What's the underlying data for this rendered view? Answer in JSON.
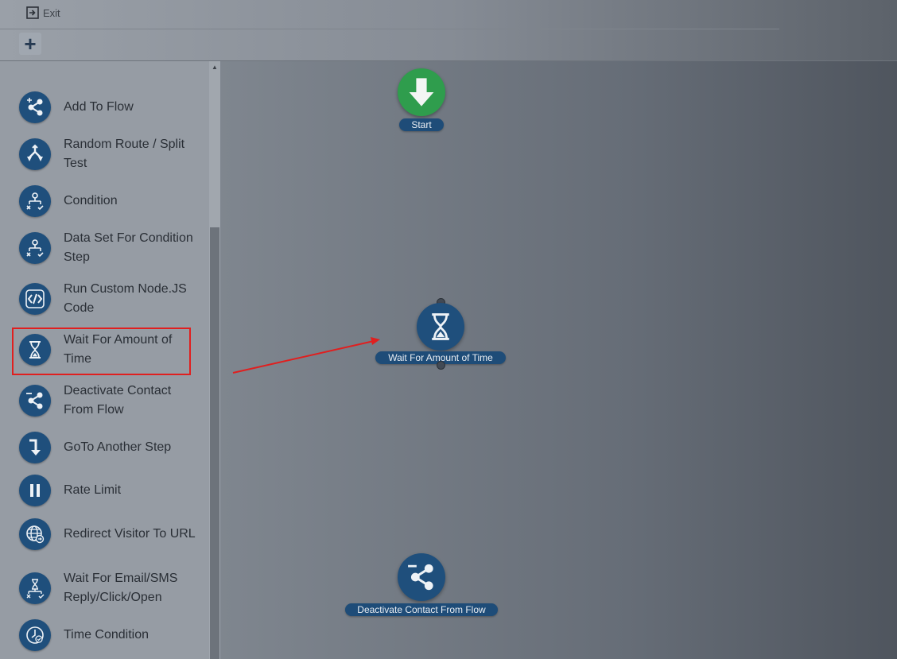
{
  "header": {
    "exit_label": "Exit",
    "add_symbol": "+"
  },
  "sidebar": {
    "items": [
      {
        "label": "Add To Flow",
        "icon": "share-icon"
      },
      {
        "label": "Random Route / Split Test",
        "icon": "split-icon"
      },
      {
        "label": "Condition",
        "icon": "condition-icon"
      },
      {
        "label": "Data Set For Condition Step",
        "icon": "condition-icon"
      },
      {
        "label": "Run Custom Node.JS Code",
        "icon": "code-icon"
      },
      {
        "label": "Wait For Amount of Time",
        "icon": "hourglass-icon"
      },
      {
        "label": "Deactivate Contact From Flow",
        "icon": "share-icon"
      },
      {
        "label": "GoTo Another Step",
        "icon": "goto-icon"
      },
      {
        "label": "Rate Limit",
        "icon": "pause-icon"
      },
      {
        "label": "Redirect Visitor To URL",
        "icon": "globe-icon"
      },
      {
        "label": "Wait For Email/SMS Reply/Click/Open",
        "icon": "hourglass-flow-icon"
      },
      {
        "label": "Time Condition",
        "icon": "clock-icon"
      }
    ]
  },
  "canvas": {
    "nodes": {
      "start": {
        "label": "Start"
      },
      "wait": {
        "label": "Wait For Amount of Time"
      },
      "deactivate": {
        "label": "Deactivate Contact From Flow"
      }
    }
  },
  "colors": {
    "node_blue": "#1f4f7c",
    "start_green": "#2f9d4d",
    "highlight_red": "#e01f1f"
  }
}
